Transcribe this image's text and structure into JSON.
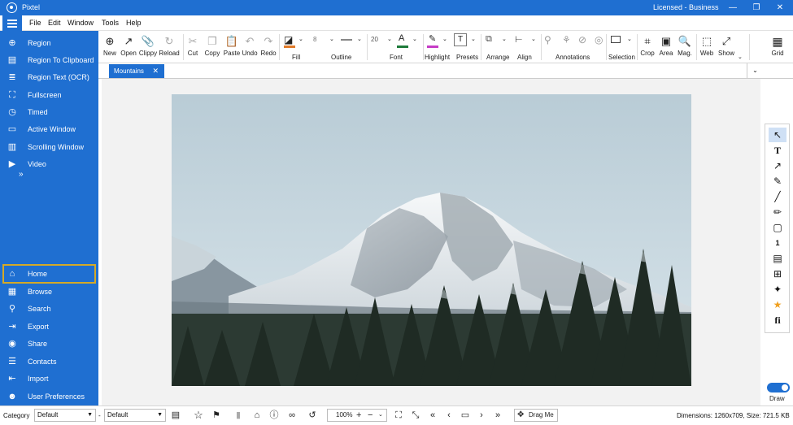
{
  "app": {
    "title": "Pixtel",
    "license": "Licensed - Business"
  },
  "window_controls": {
    "minimize": "—",
    "maximize": "❐",
    "close": "✕"
  },
  "menu": [
    "File",
    "Edit",
    "Window",
    "Tools",
    "Help"
  ],
  "sidebar": {
    "capture_items": [
      {
        "label": "Region",
        "icon": "crosshair-icon"
      },
      {
        "label": "Region To Clipboard",
        "icon": "clipboard-icon"
      },
      {
        "label": "Region Text (OCR)",
        "icon": "text-document-icon"
      },
      {
        "label": "Fullscreen",
        "icon": "fullscreen-icon"
      },
      {
        "label": "Timed",
        "icon": "timer-icon"
      },
      {
        "label": "Active Window",
        "icon": "window-icon"
      },
      {
        "label": "Scrolling Window",
        "icon": "scroll-window-icon"
      },
      {
        "label": "Video",
        "icon": "video-icon"
      }
    ],
    "more": "»",
    "nav_items": [
      {
        "label": "Home",
        "icon": "home-icon"
      },
      {
        "label": "Browse",
        "icon": "browse-icon"
      },
      {
        "label": "Search",
        "icon": "search-icon"
      },
      {
        "label": "Export",
        "icon": "export-icon"
      },
      {
        "label": "Share",
        "icon": "share-icon"
      },
      {
        "label": "Contacts",
        "icon": "contacts-icon"
      },
      {
        "label": "Import",
        "icon": "import-icon"
      },
      {
        "label": "User Preferences",
        "icon": "user-icon"
      }
    ]
  },
  "ribbon": {
    "file_buttons": [
      {
        "label": "New",
        "glyph": "⊕"
      },
      {
        "label": "Open",
        "glyph": "↗"
      },
      {
        "label": "Clippy",
        "glyph": "📎"
      },
      {
        "label": "Reload",
        "glyph": "↻"
      }
    ],
    "edit_buttons": [
      {
        "label": "Cut",
        "glyph": "✂"
      },
      {
        "label": "Copy",
        "glyph": "❐"
      },
      {
        "label": "Paste",
        "glyph": "📋"
      },
      {
        "label": "Undo",
        "glyph": "↶"
      },
      {
        "label": "Redo",
        "glyph": "↷"
      }
    ],
    "fill_label": "Fill",
    "outline_label": "Outline",
    "outline_width": "8",
    "font_label": "Font",
    "font_size": "20",
    "highlight_label": "Highlight",
    "presets_label": "Presets",
    "arrange_label": "Arrange",
    "align_label": "Align",
    "annotations_label": "Annotations",
    "selection_label": "Selection",
    "view_buttons": [
      {
        "label": "Crop",
        "glyph": "⌗"
      },
      {
        "label": "Area",
        "glyph": "▣"
      },
      {
        "label": "Mag.",
        "glyph": "🔍"
      },
      {
        "label": "Web",
        "glyph": "⬚"
      },
      {
        "label": "Show",
        "glyph": "⤢"
      }
    ],
    "grid_label": "Grid",
    "colors": {
      "fill": "#e07b2a",
      "font": "#1e7b3a",
      "highlight": "#c63cc6"
    }
  },
  "tabs": [
    {
      "label": "Mountains",
      "close": "✕"
    }
  ],
  "right_tools": [
    {
      "icon": "pointer-icon",
      "glyph": "↖"
    },
    {
      "icon": "text-tool-icon",
      "glyph": "T"
    },
    {
      "icon": "arrow-tool-icon",
      "glyph": "↗"
    },
    {
      "icon": "pen-tool-icon",
      "glyph": "✎"
    },
    {
      "icon": "line-tool-icon",
      "glyph": "╱"
    },
    {
      "icon": "marker-tool-icon",
      "glyph": "✏"
    },
    {
      "icon": "shape-tool-icon",
      "glyph": "▢"
    },
    {
      "icon": "counter-tool-icon",
      "glyph": "1"
    },
    {
      "icon": "note-tool-icon",
      "glyph": "▤"
    },
    {
      "icon": "stamp-tool-icon",
      "glyph": "⊞"
    },
    {
      "icon": "sparkle-tool-icon",
      "glyph": "✦"
    },
    {
      "icon": "star-tool-icon",
      "glyph": "★"
    },
    {
      "icon": "fx-tool-icon",
      "glyph": "fi"
    }
  ],
  "draw": {
    "label": "Draw",
    "on": true
  },
  "status": {
    "category_label": "Category",
    "category_value": "Default",
    "dash": "-",
    "second_value": "Default",
    "zoom": "100%",
    "drag_label": "Drag Me",
    "dimensions": "Dimensions: 1260x709, Size: 721.5 KB"
  }
}
